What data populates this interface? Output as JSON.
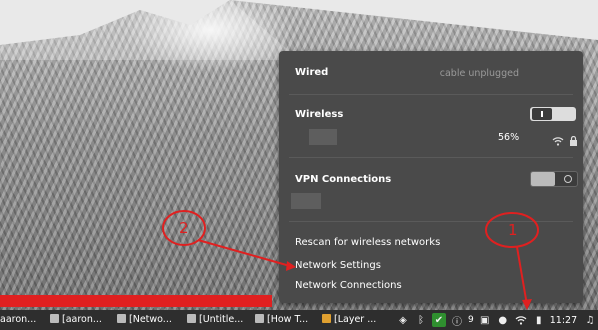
{
  "network_popup": {
    "wired": {
      "title": "Wired",
      "status": "cable unplugged"
    },
    "wireless": {
      "title": "Wireless",
      "signal": "56%",
      "toggle": "on"
    },
    "vpn": {
      "title": "VPN Connections",
      "toggle": "off"
    },
    "menu": {
      "rescan": "Rescan for wireless networks",
      "network_settings": "Network Settings",
      "network_connections": "Network Connections"
    }
  },
  "annotations": {
    "marker1": "1",
    "marker2": "2",
    "color": "#e02020"
  },
  "taskbar": {
    "tasks": [
      "aaron...",
      "[aaron...",
      "[Netwo...",
      "[Untitle...",
      "[How T...",
      "[Layer ..."
    ],
    "tray_count": "9",
    "clock": "11:27"
  },
  "icons": [
    "shield-icon",
    "bluetooth-icon",
    "checkmark-icon",
    "info-icon",
    "dropbox-icon",
    "user-icon",
    "wifi-icon",
    "battery-icon",
    "music-icon",
    "lock-icon"
  ]
}
